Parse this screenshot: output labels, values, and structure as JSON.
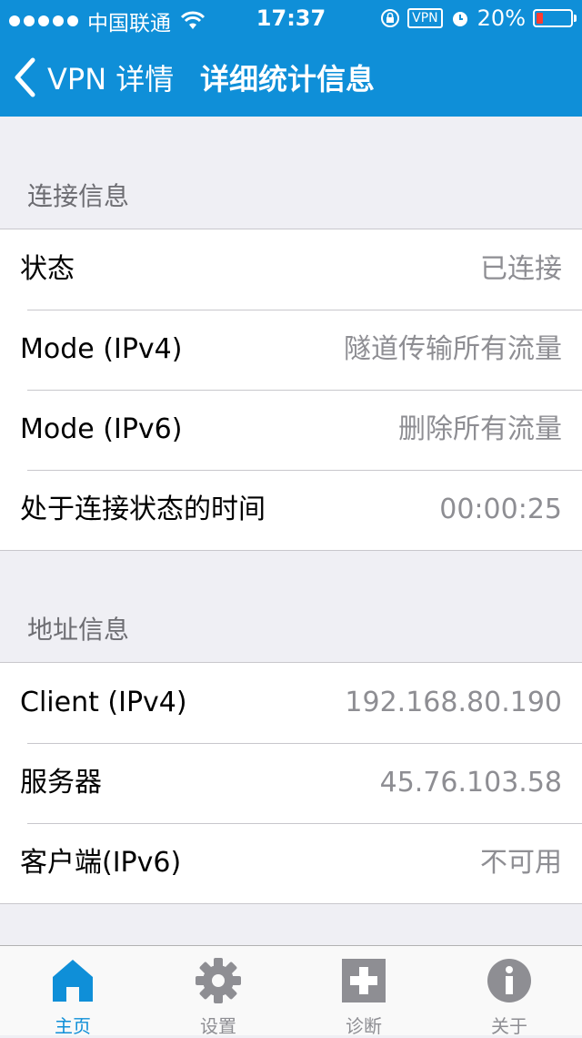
{
  "status_bar": {
    "carrier": "中国联通",
    "time": "17:37",
    "vpn_badge": "VPN",
    "battery_percent": "20%",
    "battery_level": 0.2
  },
  "nav": {
    "back_label": "VPN 详情",
    "title": "详细统计信息"
  },
  "sections": {
    "connection": {
      "header": "连接信息",
      "rows": [
        {
          "label": "状态",
          "value": "已连接"
        },
        {
          "label": "Mode (IPv4)",
          "value": "隧道传输所有流量"
        },
        {
          "label": "Mode (IPv6)",
          "value": "删除所有流量"
        },
        {
          "label": "处于连接状态的时间",
          "value": "00:00:25"
        }
      ]
    },
    "address": {
      "header": "地址信息",
      "rows": [
        {
          "label": "Client (IPv4)",
          "value": "192.168.80.190"
        },
        {
          "label": "服务器",
          "value": "45.76.103.58"
        },
        {
          "label": "客户端(IPv6)",
          "value": "不可用"
        }
      ]
    }
  },
  "tabbar": {
    "tabs": [
      {
        "label": "主页",
        "icon": "home-icon",
        "active": true
      },
      {
        "label": "设置",
        "icon": "gear-icon",
        "active": false
      },
      {
        "label": "诊断",
        "icon": "plus-box-icon",
        "active": false
      },
      {
        "label": "关于",
        "icon": "info-icon",
        "active": false
      }
    ]
  },
  "colors": {
    "accent": "#0f8fd8",
    "inactive_tab": "#8e8e93",
    "background": "#efeff4"
  }
}
